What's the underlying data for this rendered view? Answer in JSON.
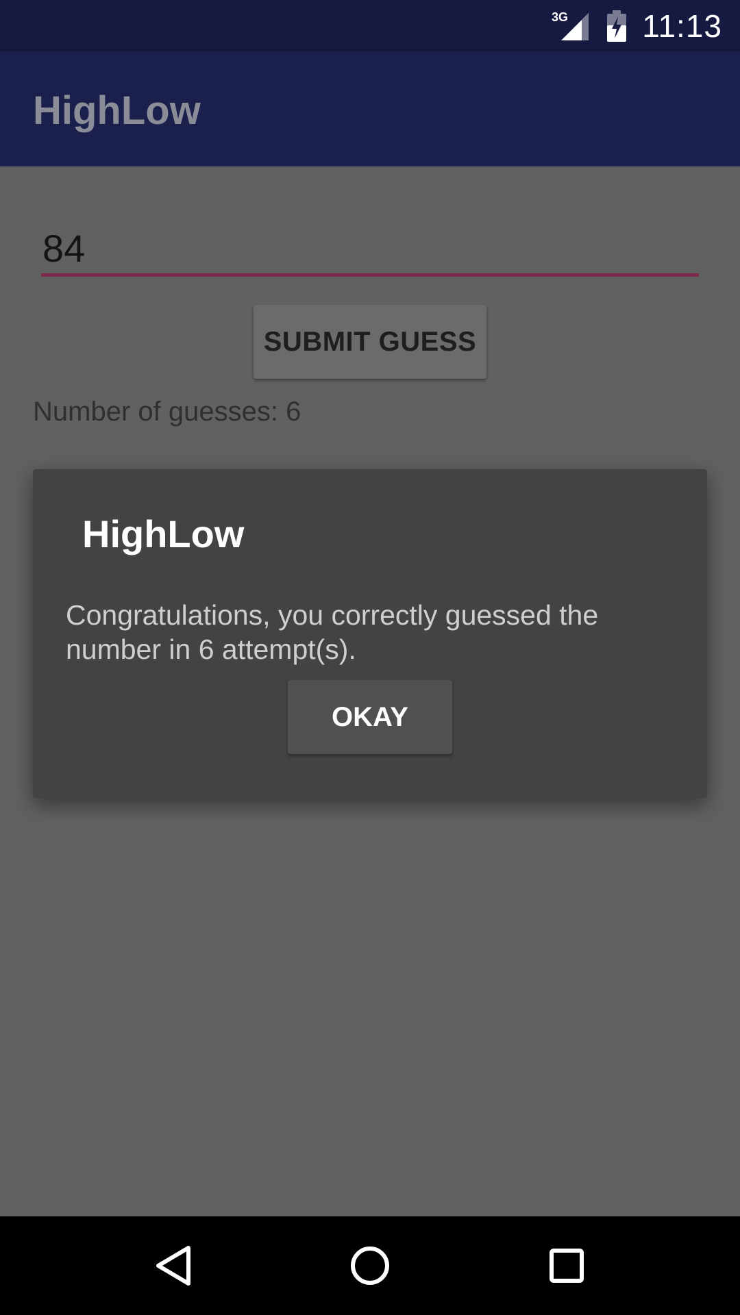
{
  "status_bar": {
    "network_label": "3G",
    "time": "11:13",
    "icons": [
      "signal-3g-icon",
      "battery-charging-icon"
    ]
  },
  "app_bar": {
    "title": "HighLow",
    "colors": {
      "status_bar": "#171a40",
      "app_bar": "#1a1f4c"
    }
  },
  "main": {
    "guess_input": {
      "value": "84",
      "underline_color": "#7d2a4c"
    },
    "submit_label": "SUBMIT GUESS",
    "guess_count_text": "Number of guesses: 6"
  },
  "dialog": {
    "title": "HighLow",
    "message": "Congratulations, you correctly guessed the number in 6 attempt(s).",
    "okay_label": "OKAY"
  },
  "nav_bar": {
    "icons": [
      "back-icon",
      "home-icon",
      "recents-icon"
    ]
  }
}
